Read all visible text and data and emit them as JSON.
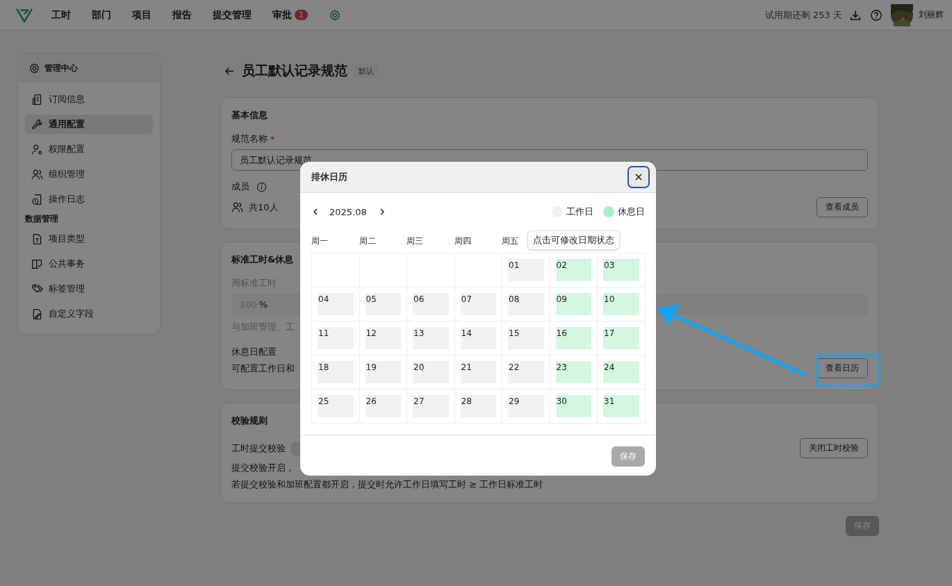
{
  "nav": {
    "items": [
      {
        "label": "工时"
      },
      {
        "label": "部门"
      },
      {
        "label": "项目"
      },
      {
        "label": "报告"
      },
      {
        "label": "提交管理"
      },
      {
        "label": "审批",
        "badge": "1"
      }
    ],
    "trial": "试用期还剩 253 天",
    "user": "刘丽辉"
  },
  "sidebar": {
    "title": "管理中心",
    "groups": [
      {
        "items": [
          {
            "label": "订阅信息",
            "selected": false
          },
          {
            "label": "通用配置",
            "selected": true
          },
          {
            "label": "权限配置",
            "selected": false
          },
          {
            "label": "组织管理",
            "selected": false
          },
          {
            "label": "操作日志",
            "selected": false
          }
        ]
      },
      {
        "title": "数据管理",
        "items": [
          {
            "label": "项目类型",
            "selected": false
          },
          {
            "label": "公共事务",
            "selected": false
          },
          {
            "label": "标签管理",
            "selected": false
          },
          {
            "label": "自定义字段",
            "selected": false
          }
        ]
      }
    ]
  },
  "page": {
    "title": "员工默认记录规范",
    "tag": "默认",
    "basic": {
      "heading": "基本信息",
      "name_label": "规范名称",
      "required": "*",
      "name_value": "员工默认记录规范",
      "members_label": "成员",
      "members_count": "共10人",
      "button": "查看成员"
    },
    "standard": {
      "heading": "标准工时&休息",
      "week_label": "周标准工时",
      "week_value": "100",
      "unit": "%",
      "note": "与加班管理、工",
      "rest_label": "休息日配置",
      "rest_note": "可配置工作日和",
      "button": "查看日历"
    },
    "check": {
      "heading": "校验规则",
      "label": "工时提交校验",
      "line_1": "提交校验开启，",
      "line_2": "若提交校验和加班配置都开启，提交时允许工作日填写工时 ≥ 工作日标准工时",
      "button": "关闭工时校验"
    },
    "save": {
      "label": "保存",
      "disabled": true
    }
  },
  "modal": {
    "title": "排休日历",
    "month": "2025.08",
    "legend": [
      {
        "label": "工作日",
        "kind": "workday"
      },
      {
        "label": "休息日",
        "kind": "holiday"
      }
    ],
    "weekdays": [
      "周一",
      "周二",
      "周三",
      "周四",
      "周五"
    ],
    "tooltip": "点击可修改日期状态",
    "weeks": [
      [
        {
          "day": "01",
          "rest": false
        },
        {
          "day": "02",
          "rest": true
        },
        {
          "day": "03",
          "rest": true
        }
      ],
      [
        {
          "day": "04",
          "rest": false
        },
        {
          "day": "05",
          "rest": false
        },
        {
          "day": "06",
          "rest": false
        },
        {
          "day": "07",
          "rest": false
        },
        {
          "day": "08",
          "rest": false
        },
        {
          "day": "09",
          "rest": true
        },
        {
          "day": "10",
          "rest": true
        }
      ],
      [
        {
          "day": "11",
          "rest": false
        },
        {
          "day": "12",
          "rest": false
        },
        {
          "day": "13",
          "rest": false
        },
        {
          "day": "14",
          "rest": false
        },
        {
          "day": "15",
          "rest": false
        },
        {
          "day": "16",
          "rest": true
        },
        {
          "day": "17",
          "rest": true
        }
      ],
      [
        {
          "day": "18",
          "rest": false
        },
        {
          "day": "19",
          "rest": false
        },
        {
          "day": "20",
          "rest": false
        },
        {
          "day": "21",
          "rest": false
        },
        {
          "day": "22",
          "rest": false
        },
        {
          "day": "23",
          "rest": true
        },
        {
          "day": "24",
          "rest": true
        }
      ],
      [
        {
          "day": "25",
          "rest": false
        },
        {
          "day": "26",
          "rest": false
        },
        {
          "day": "27",
          "rest": false
        },
        {
          "day": "28",
          "rest": false
        },
        {
          "day": "29",
          "rest": false
        },
        {
          "day": "30",
          "rest": true
        },
        {
          "day": "31",
          "rest": true
        }
      ]
    ],
    "save": {
      "label": "保存",
      "disabled": true
    }
  }
}
